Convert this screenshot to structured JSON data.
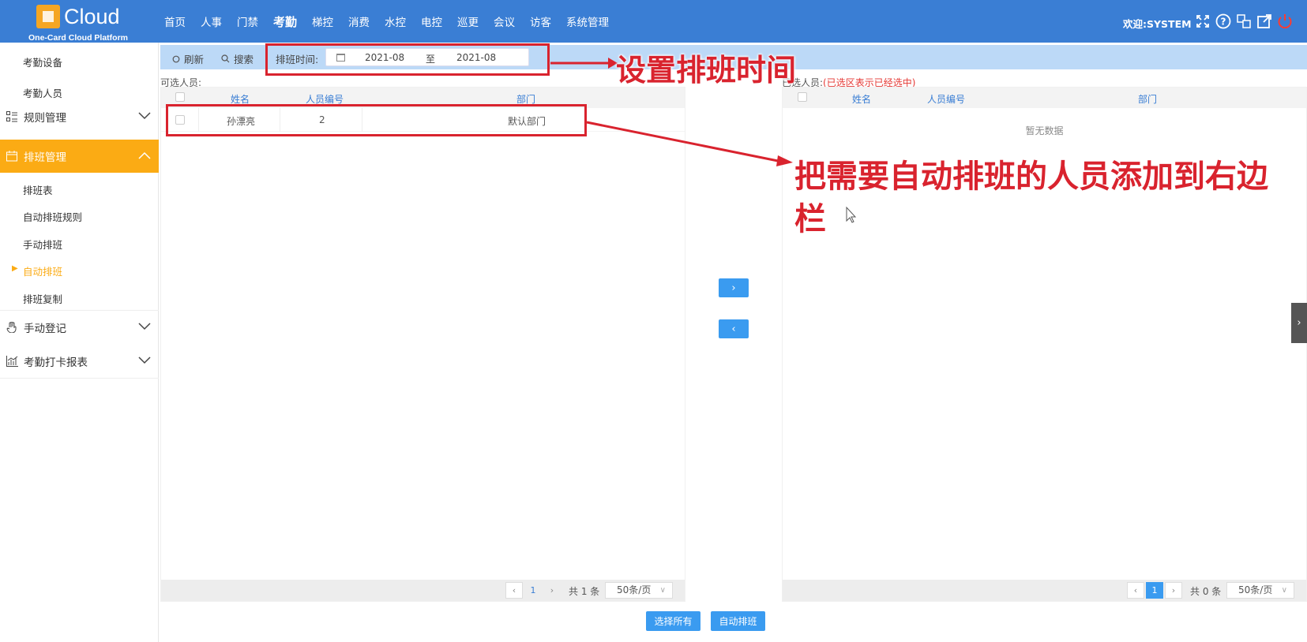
{
  "header": {
    "logo_text": "Cloud",
    "logo_sub": "One-Card Cloud Platform",
    "nav": [
      "首页",
      "人事",
      "门禁",
      "考勤",
      "梯控",
      "消费",
      "水控",
      "电控",
      "巡更",
      "会议",
      "访客",
      "系统管理"
    ],
    "active_nav": "考勤",
    "welcome": "欢迎:SYSTEM"
  },
  "sidebar": {
    "top_items": [
      "考勤设备",
      "考勤人员"
    ],
    "groups": {
      "rules": "规则管理",
      "schedule": "排班管理",
      "manual_register": "手动登记",
      "report": "考勤打卡报表"
    },
    "schedule_items": [
      "排班表",
      "自动排班规则",
      "手动排班",
      "自动排班",
      "排班复制"
    ],
    "active_item": "自动排班",
    "accent": "#fbab14"
  },
  "toolbar": {
    "refresh": "刷新",
    "search": "搜索",
    "time_label": "排班时间:",
    "date_from": "2021-08",
    "date_sep": "至",
    "date_to": "2021-08"
  },
  "left_panel": {
    "label": "可选人员:",
    "columns": [
      "姓名",
      "人员编号",
      "部门"
    ],
    "rows": [
      {
        "name": "孙漂亮",
        "id": "2",
        "dept": "默认部门"
      }
    ],
    "pager": {
      "page": "1",
      "total": "共 1 条",
      "page_size": "50条/页"
    }
  },
  "right_panel": {
    "label": "已选人员:",
    "note": "(已选区表示已经选中)",
    "columns": [
      "姓名",
      "人员编号",
      "部门"
    ],
    "empty": "暂无数据",
    "pager": {
      "page": "1",
      "total": "共 0 条",
      "page_size": "50条/页"
    }
  },
  "move": {
    "right": "›",
    "left": "‹"
  },
  "actions": {
    "select_all": "选择所有",
    "auto_schedule": "自动排班"
  },
  "annotations": {
    "set_time": "设置排班时间",
    "add_people_line1": "把需要自动排班的人员添加到右边",
    "add_people_line2": "栏"
  },
  "colors": {
    "primary": "#3a7ed4",
    "button": "#3a9bf0",
    "annotation": "#d9232e"
  }
}
